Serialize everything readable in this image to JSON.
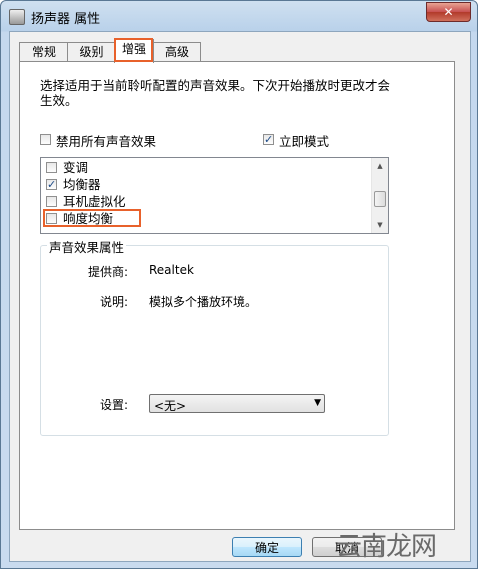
{
  "window": {
    "title": "扬声器 属性",
    "close_glyph": "✕"
  },
  "tabs": [
    {
      "label": "常规"
    },
    {
      "label": "级别"
    },
    {
      "label": "增强"
    },
    {
      "label": "高级"
    }
  ],
  "description": "选择适用于当前聆听配置的声音效果。下次开始播放时更改才会生效。",
  "disable_all": {
    "label": "禁用所有声音效果",
    "checked": false
  },
  "immediate_mode": {
    "label": "立即模式",
    "checked": true
  },
  "effects": [
    {
      "label": "变调",
      "checked": false
    },
    {
      "label": "均衡器",
      "checked": true
    },
    {
      "label": "耳机虚拟化",
      "checked": false
    },
    {
      "label": "响度均衡",
      "checked": false
    }
  ],
  "properties": {
    "group_title": "声音效果属性",
    "provider_label": "提供商:",
    "provider_value": "Realtek",
    "description_label": "说明:",
    "description_value": "模拟多个播放环境。",
    "settings_label": "设置:",
    "settings_value": "<无>"
  },
  "buttons": {
    "ok": "确定",
    "cancel": "取消"
  },
  "watermark": "云南龙网",
  "colors": {
    "highlight": "#e8612b",
    "check": "#1c4a86"
  }
}
